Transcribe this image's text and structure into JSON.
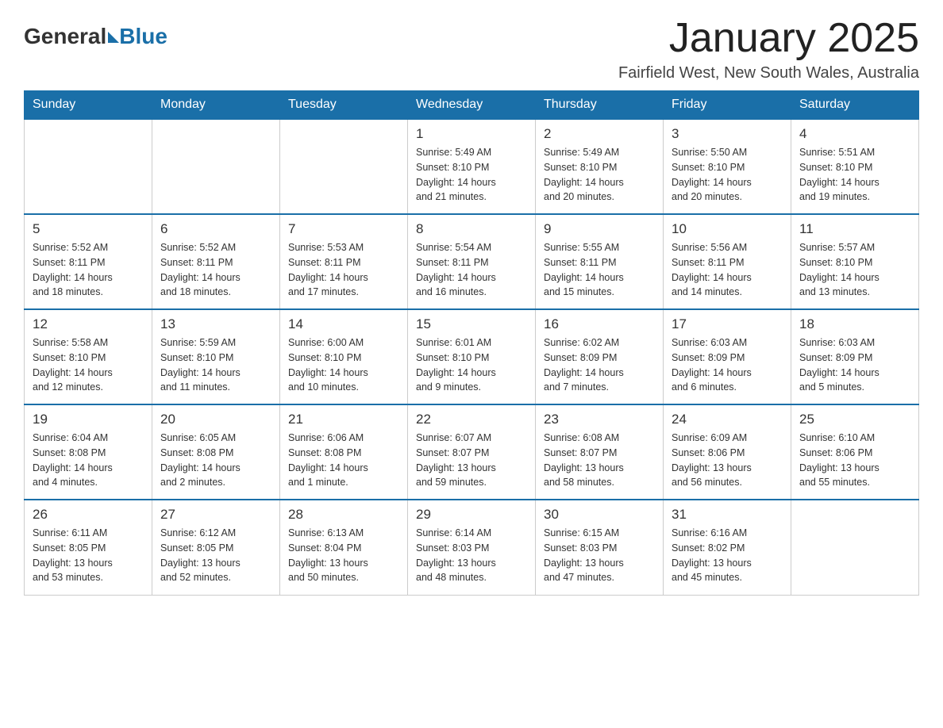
{
  "header": {
    "logo_general": "General",
    "logo_blue": "Blue",
    "month_title": "January 2025",
    "location": "Fairfield West, New South Wales, Australia"
  },
  "days_of_week": [
    "Sunday",
    "Monday",
    "Tuesday",
    "Wednesday",
    "Thursday",
    "Friday",
    "Saturday"
  ],
  "weeks": [
    [
      {
        "day": "",
        "info": ""
      },
      {
        "day": "",
        "info": ""
      },
      {
        "day": "",
        "info": ""
      },
      {
        "day": "1",
        "info": "Sunrise: 5:49 AM\nSunset: 8:10 PM\nDaylight: 14 hours\nand 21 minutes."
      },
      {
        "day": "2",
        "info": "Sunrise: 5:49 AM\nSunset: 8:10 PM\nDaylight: 14 hours\nand 20 minutes."
      },
      {
        "day": "3",
        "info": "Sunrise: 5:50 AM\nSunset: 8:10 PM\nDaylight: 14 hours\nand 20 minutes."
      },
      {
        "day": "4",
        "info": "Sunrise: 5:51 AM\nSunset: 8:10 PM\nDaylight: 14 hours\nand 19 minutes."
      }
    ],
    [
      {
        "day": "5",
        "info": "Sunrise: 5:52 AM\nSunset: 8:11 PM\nDaylight: 14 hours\nand 18 minutes."
      },
      {
        "day": "6",
        "info": "Sunrise: 5:52 AM\nSunset: 8:11 PM\nDaylight: 14 hours\nand 18 minutes."
      },
      {
        "day": "7",
        "info": "Sunrise: 5:53 AM\nSunset: 8:11 PM\nDaylight: 14 hours\nand 17 minutes."
      },
      {
        "day": "8",
        "info": "Sunrise: 5:54 AM\nSunset: 8:11 PM\nDaylight: 14 hours\nand 16 minutes."
      },
      {
        "day": "9",
        "info": "Sunrise: 5:55 AM\nSunset: 8:11 PM\nDaylight: 14 hours\nand 15 minutes."
      },
      {
        "day": "10",
        "info": "Sunrise: 5:56 AM\nSunset: 8:11 PM\nDaylight: 14 hours\nand 14 minutes."
      },
      {
        "day": "11",
        "info": "Sunrise: 5:57 AM\nSunset: 8:10 PM\nDaylight: 14 hours\nand 13 minutes."
      }
    ],
    [
      {
        "day": "12",
        "info": "Sunrise: 5:58 AM\nSunset: 8:10 PM\nDaylight: 14 hours\nand 12 minutes."
      },
      {
        "day": "13",
        "info": "Sunrise: 5:59 AM\nSunset: 8:10 PM\nDaylight: 14 hours\nand 11 minutes."
      },
      {
        "day": "14",
        "info": "Sunrise: 6:00 AM\nSunset: 8:10 PM\nDaylight: 14 hours\nand 10 minutes."
      },
      {
        "day": "15",
        "info": "Sunrise: 6:01 AM\nSunset: 8:10 PM\nDaylight: 14 hours\nand 9 minutes."
      },
      {
        "day": "16",
        "info": "Sunrise: 6:02 AM\nSunset: 8:09 PM\nDaylight: 14 hours\nand 7 minutes."
      },
      {
        "day": "17",
        "info": "Sunrise: 6:03 AM\nSunset: 8:09 PM\nDaylight: 14 hours\nand 6 minutes."
      },
      {
        "day": "18",
        "info": "Sunrise: 6:03 AM\nSunset: 8:09 PM\nDaylight: 14 hours\nand 5 minutes."
      }
    ],
    [
      {
        "day": "19",
        "info": "Sunrise: 6:04 AM\nSunset: 8:08 PM\nDaylight: 14 hours\nand 4 minutes."
      },
      {
        "day": "20",
        "info": "Sunrise: 6:05 AM\nSunset: 8:08 PM\nDaylight: 14 hours\nand 2 minutes."
      },
      {
        "day": "21",
        "info": "Sunrise: 6:06 AM\nSunset: 8:08 PM\nDaylight: 14 hours\nand 1 minute."
      },
      {
        "day": "22",
        "info": "Sunrise: 6:07 AM\nSunset: 8:07 PM\nDaylight: 13 hours\nand 59 minutes."
      },
      {
        "day": "23",
        "info": "Sunrise: 6:08 AM\nSunset: 8:07 PM\nDaylight: 13 hours\nand 58 minutes."
      },
      {
        "day": "24",
        "info": "Sunrise: 6:09 AM\nSunset: 8:06 PM\nDaylight: 13 hours\nand 56 minutes."
      },
      {
        "day": "25",
        "info": "Sunrise: 6:10 AM\nSunset: 8:06 PM\nDaylight: 13 hours\nand 55 minutes."
      }
    ],
    [
      {
        "day": "26",
        "info": "Sunrise: 6:11 AM\nSunset: 8:05 PM\nDaylight: 13 hours\nand 53 minutes."
      },
      {
        "day": "27",
        "info": "Sunrise: 6:12 AM\nSunset: 8:05 PM\nDaylight: 13 hours\nand 52 minutes."
      },
      {
        "day": "28",
        "info": "Sunrise: 6:13 AM\nSunset: 8:04 PM\nDaylight: 13 hours\nand 50 minutes."
      },
      {
        "day": "29",
        "info": "Sunrise: 6:14 AM\nSunset: 8:03 PM\nDaylight: 13 hours\nand 48 minutes."
      },
      {
        "day": "30",
        "info": "Sunrise: 6:15 AM\nSunset: 8:03 PM\nDaylight: 13 hours\nand 47 minutes."
      },
      {
        "day": "31",
        "info": "Sunrise: 6:16 AM\nSunset: 8:02 PM\nDaylight: 13 hours\nand 45 minutes."
      },
      {
        "day": "",
        "info": ""
      }
    ]
  ]
}
